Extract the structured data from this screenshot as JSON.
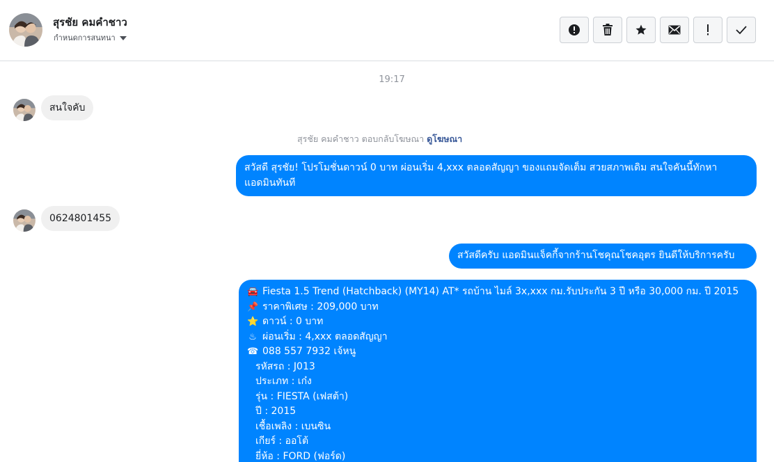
{
  "header": {
    "name": "สุรชัย คมคำชาว",
    "subtitle": "กำหนดการสนทนา"
  },
  "actions": [
    {
      "name": "alert-icon"
    },
    {
      "name": "trash-icon"
    },
    {
      "name": "star-icon"
    },
    {
      "name": "mail-icon"
    },
    {
      "name": "exclamation-icon"
    },
    {
      "name": "check-icon"
    }
  ],
  "conversation": {
    "timestamp": "19:17",
    "incoming_1": "สนใจคับ",
    "ad_reply_note": "สุรชัย คมคำชาว ตอบกลับโฆษณา",
    "ad_link": "ดูโฆษณา",
    "outgoing_1_line1": "สวัสดี สุรชัย! โปรโมชั่นดาวน์ 0 บาท ผ่อนเริ่ม 4,xxx ตลอดสัญญา ของแถมจัดเต็ม สวยสภาพเดิม สนใจคันนี้ทักหา",
    "outgoing_1_line2": "แอดมินทันที",
    "incoming_2": "0624801455",
    "outgoing_2": "สวัสดีครับ แอดมินแจ็คกี้จากร้านโชคุณโชคอุตร ยินดีให้บริการครับ",
    "listing": {
      "title": "Fiesta 1.5 Trend (Hatchback) (MY14) AT* รถบ้าน ไมล์ 3x,xxx กม.รับประกัน 3 ปี หรือ 30,000 กม. ปี 2015",
      "price": "ราคาพิเศษ : 209,000 บาท",
      "down": "ดาวน์ : 0 บาท",
      "installment": "ผ่อนเริ่ม : 4,xxx ตลอดสัญญา",
      "phone": "088 557 7932 เจ้หนู",
      "code": "รหัสรถ : J013",
      "type": "ประเภท : เก๋ง",
      "model": "รุ่น : FIESTA (เฟสต้า)",
      "year": "ปี : 2015",
      "fuel": "เชื้อเพลิง : เบนซิน",
      "gear": "เกียร์ : ออโต้",
      "brand": "ยี่ห้อ : FORD (ฟอร์ด)"
    },
    "listing_icons": {
      "title": "🚘",
      "price": "📌",
      "down": "⭐",
      "installment": "♨",
      "phone": "☎"
    }
  },
  "colors": {
    "outgoing_bubble": "#0084ff",
    "incoming_bubble": "#f0f0f0",
    "link": "#385898"
  }
}
